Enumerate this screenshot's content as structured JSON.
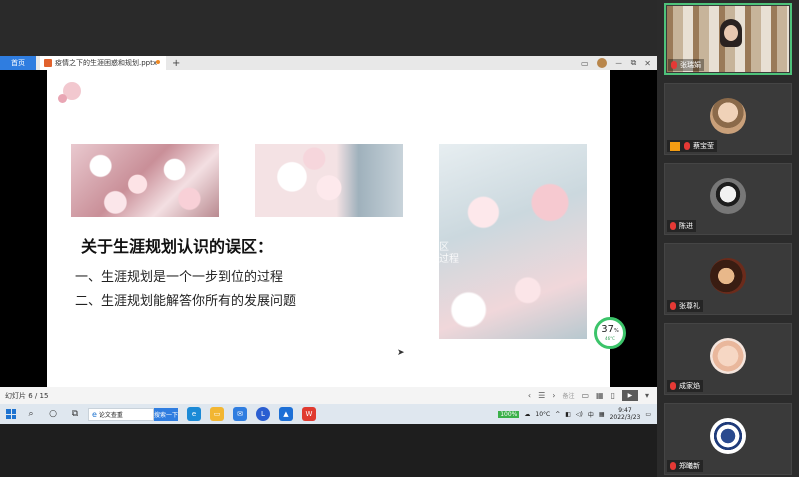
{
  "app": {
    "home_tab": "首页",
    "doc_tab": "疫情之下的生涯困惑和规划.pptx",
    "new_tab": "+",
    "ctrl_min": "－",
    "ctrl_restore": "⧉",
    "ctrl_close": "✕"
  },
  "slide": {
    "heading": "关于生涯规划认识的误区：",
    "line1": "一、生涯规划是一个一步到位的过程",
    "line2": "二、生涯规划能解答你所有的发展问题",
    "ghost_text1": "区",
    "ghost_text2": "过程"
  },
  "gauge": {
    "value": "37",
    "unit": "%",
    "temp": "46°C"
  },
  "statusbar": {
    "slide_counter": "幻灯片 6 / 15",
    "note": "备注",
    "prev": "‹",
    "list": "☰",
    "next": "›",
    "play": "▶",
    "more": "▾"
  },
  "taskbar": {
    "search_text": "论文查重",
    "search_button": "搜索一下",
    "battery": "100%",
    "weather": "10°C",
    "ime": "中",
    "time": "9:47",
    "date": "2022/3/23"
  },
  "participants": [
    {
      "name": "张瑞娟"
    },
    {
      "name": "蔡宝莹"
    },
    {
      "name": "陈进"
    },
    {
      "name": "张尊礼"
    },
    {
      "name": "成家焰"
    },
    {
      "name": "郑曦新"
    }
  ],
  "colors": {
    "accent_blue": "#2f7de0",
    "active_tile": "#4ec27a",
    "ppt_orange": "#e1622d"
  }
}
